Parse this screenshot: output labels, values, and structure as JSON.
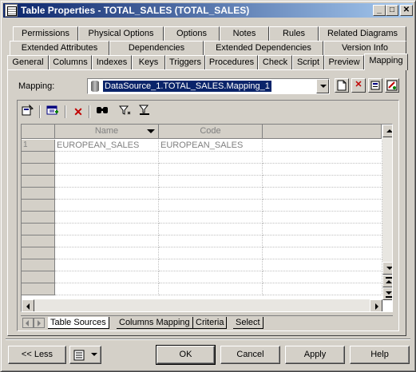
{
  "window": {
    "title": "Table Properties - TOTAL_SALES (TOTAL_SALES)",
    "minimize": "_",
    "maximize": "□",
    "close": "✕"
  },
  "tabs": {
    "row1": [
      "Permissions",
      "Physical Options",
      "Options",
      "Notes",
      "Rules",
      "Related Diagrams"
    ],
    "row2": [
      "Extended Attributes",
      "Dependencies",
      "Extended Dependencies",
      "Version Info"
    ],
    "row3": [
      "General",
      "Columns",
      "Indexes",
      "Keys",
      "Triggers",
      "Procedures",
      "Check",
      "Script",
      "Preview",
      "Mapping"
    ],
    "active": "Mapping"
  },
  "mapping": {
    "label": "Mapping:",
    "value": "DataSource_1.TOTAL_SALES.Mapping_1"
  },
  "icons": {
    "properties": "properties-icon",
    "add_source": "add-source-icon",
    "delete": "delete-icon",
    "find": "find-icon",
    "filter": "filter-icon",
    "clear_filter": "clear-filter-icon"
  },
  "grid": {
    "columns": [
      "Name",
      "Code"
    ],
    "rows": [
      {
        "num": "1",
        "name": "EUROPEAN_SALES",
        "code": "EUROPEAN_SALES"
      }
    ]
  },
  "subtabs": [
    "Table Sources",
    "Columns Mapping",
    "Criteria",
    "Select"
  ],
  "subtab_active": "Table Sources",
  "buttons": {
    "less": "<< Less",
    "ok": "OK",
    "cancel": "Cancel",
    "apply": "Apply",
    "help": "Help"
  }
}
